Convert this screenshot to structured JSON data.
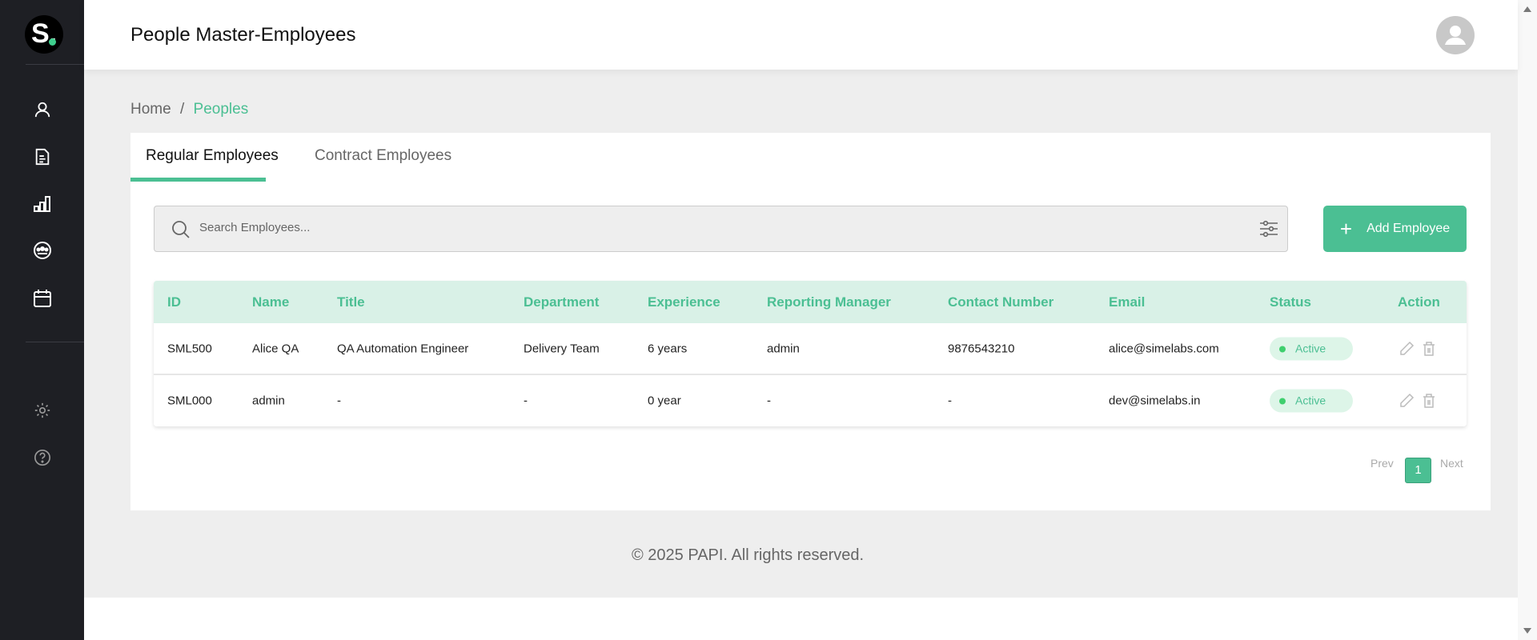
{
  "header": {
    "title": "People Master-Employees"
  },
  "logo": {
    "text": "S."
  },
  "sidebar": {
    "items": [
      "user-icon",
      "document-icon",
      "chart-icon",
      "team-icon",
      "calendar-icon",
      "gear-icon",
      "help-icon"
    ]
  },
  "breadcrumb": {
    "home": "Home",
    "separator": "/",
    "current": "Peoples"
  },
  "tabs": [
    {
      "label": "Regular Employees",
      "active": true
    },
    {
      "label": "Contract Employees",
      "active": false
    }
  ],
  "search": {
    "placeholder": "Search Employees...",
    "value": ""
  },
  "add_button": {
    "label": "Add Employee"
  },
  "table": {
    "columns": [
      "ID",
      "Name",
      "Title",
      "Department",
      "Experience",
      "Reporting Manager",
      "Contact Number",
      "Email",
      "Status",
      "Action"
    ],
    "rows": [
      [
        "SML500",
        "Alice QA",
        "QA Automation Engineer",
        "Delivery Team",
        "6 years",
        "admin",
        "9876543210",
        "alice@simelabs.com",
        "Active"
      ],
      [
        "SML000",
        "admin",
        "-",
        "-",
        "0 year",
        "-",
        "-",
        "dev@simelabs.in",
        "Active"
      ]
    ]
  },
  "pagination": {
    "prev": "Prev",
    "current": "1",
    "next": "Next"
  },
  "footer": {
    "text": "© 2025 PAPI. All rights reserved."
  },
  "colors": {
    "accent": "#4bbf93",
    "sidebar": "#1e1f24",
    "header_row": "#d9f1e7",
    "badge": "#ddf5e8"
  }
}
